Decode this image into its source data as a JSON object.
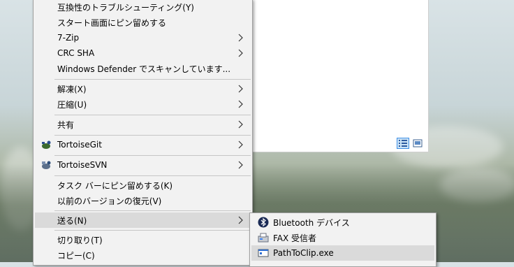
{
  "context_menu": {
    "items": [
      {
        "label": "互換性のトラブルシューティング(Y)"
      },
      {
        "label": "スタート画面にピン留めする"
      },
      {
        "label": "7-Zip"
      },
      {
        "label": "CRC SHA"
      },
      {
        "label": "Windows Defender でスキャンしています..."
      },
      {
        "label": "解凍(X)"
      },
      {
        "label": "圧縮(U)"
      },
      {
        "label": "共有"
      },
      {
        "label": "TortoiseGit",
        "icon": "tortoisegit-icon"
      },
      {
        "label": "TortoiseSVN",
        "icon": "tortoisesvn-icon"
      },
      {
        "label": "タスク バーにピン留めする(K)"
      },
      {
        "label": "以前のバージョンの復元(V)"
      },
      {
        "label": "送る(N)"
      },
      {
        "label": "切り取り(T)"
      },
      {
        "label": "コピー(C)"
      }
    ]
  },
  "send_to_submenu": {
    "items": [
      {
        "label": "Bluetooth デバイス",
        "icon": "bluetooth-icon"
      },
      {
        "label": "FAX 受信者",
        "icon": "fax-icon"
      },
      {
        "label": "PathToClip.exe",
        "icon": "app-icon"
      }
    ]
  },
  "explorer_window": {
    "view_buttons": [
      "details-view-icon",
      "large-icons-view-icon"
    ]
  },
  "colors": {
    "menu_bg": "#f2f2f2",
    "highlight": "#dadada",
    "separator": "#c6c6c6",
    "accent": "#3d8ee5"
  }
}
